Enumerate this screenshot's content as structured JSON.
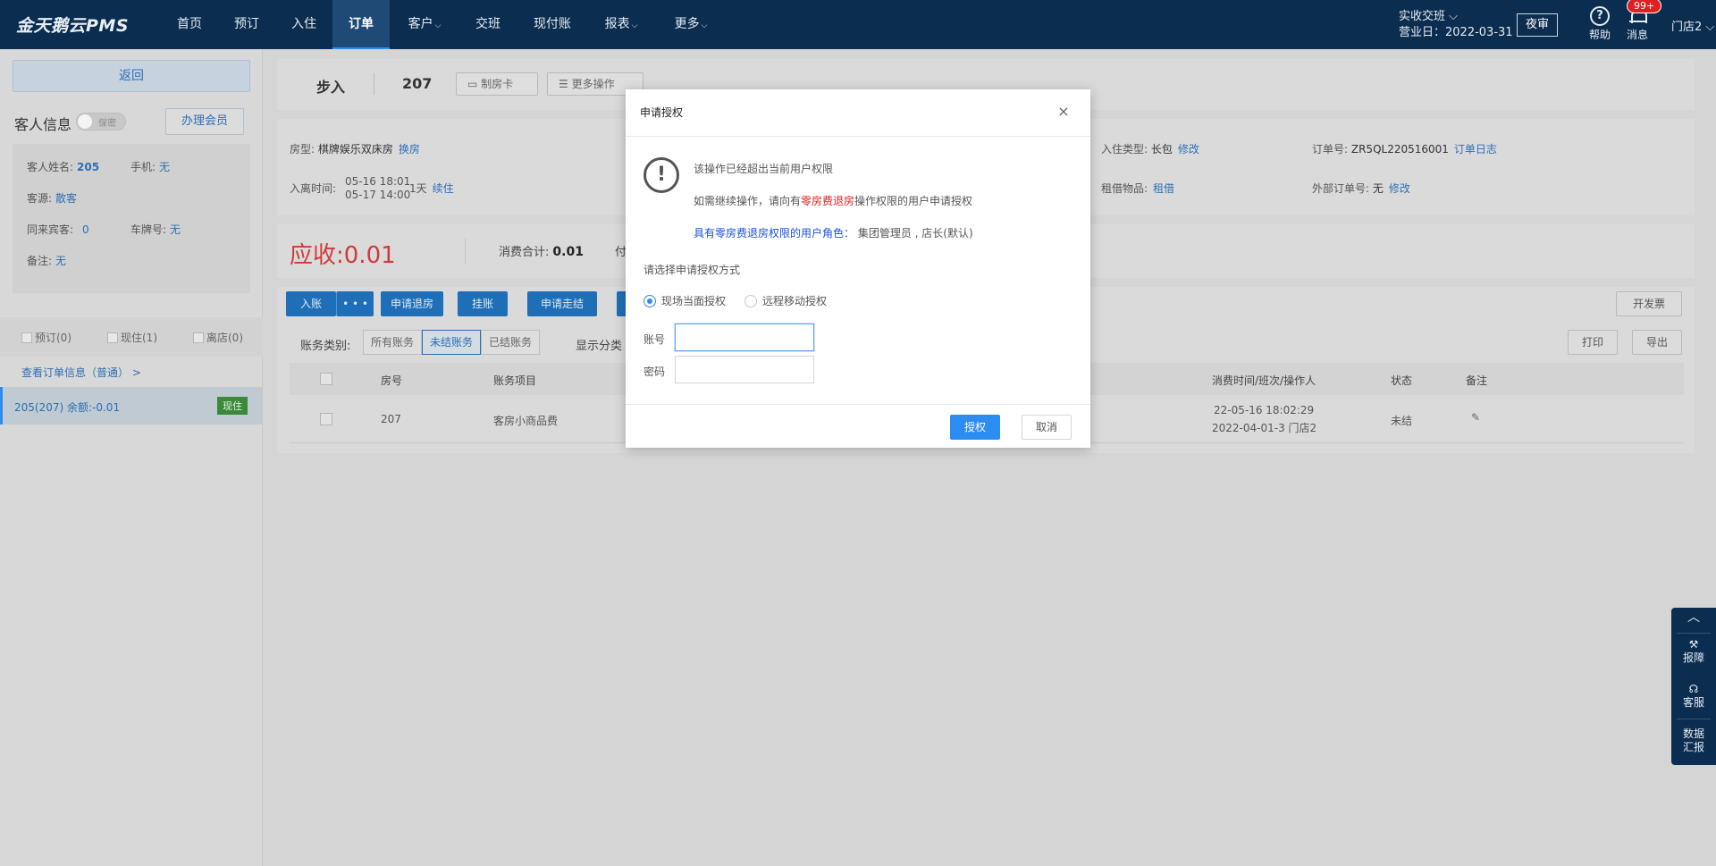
{
  "app": {
    "logo": "金天鹅云PMS"
  },
  "nav": {
    "items": [
      {
        "label": "首页"
      },
      {
        "label": "预订"
      },
      {
        "label": "入住"
      },
      {
        "label": "订单"
      },
      {
        "label": "客户"
      },
      {
        "label": "交班"
      },
      {
        "label": "现付账"
      },
      {
        "label": "报表"
      },
      {
        "label": "更多"
      }
    ],
    "caret": "⌵",
    "shift_label": "实收交班 ⌵",
    "business_day": "营业日：2022-03-31",
    "audit_label": "夜审",
    "help_label": "帮助",
    "help_glyph": "?",
    "msg_label": "消息",
    "msg_badge": "99+",
    "store_label": "门店2 ⌵"
  },
  "left": {
    "back_label": "返回",
    "guest_info_title": "客人信息",
    "privacy_label": "保密",
    "member_label": "办理会员",
    "guest": {
      "name_label": "客人姓名:",
      "name_value": "205",
      "phone_label": "手机:",
      "phone_value": "无",
      "source_label": "客源:",
      "source_value": "散客",
      "companions_label": "同来宾客:",
      "companions_value": "0",
      "plate_label": "车牌号:",
      "plate_value": "无",
      "note_label": "备注:",
      "note_value": "无"
    },
    "filters": [
      {
        "label": "预订(0)"
      },
      {
        "label": "现住(1)"
      },
      {
        "label": "离店(0)"
      }
    ],
    "order_link": "查看订单信息（普通） >",
    "room_item": {
      "label": "205(207)   余额:-0.01",
      "badge": "现住"
    }
  },
  "header": {
    "walkin": "步入",
    "room": "207",
    "make_card_label": "制房卡",
    "more_ops_label": "更多操作"
  },
  "details": {
    "room_type_label": "房型:",
    "room_type_value": "棋牌娱乐双床房",
    "change_room": "换房",
    "stay_label": "入离时间:",
    "stay_in": "05-16 18:01",
    "stay_out": "05-17 14:00",
    "nights": "1天",
    "extend": "续住",
    "checkin_type_label": "入住类型:",
    "checkin_type_value": "长包",
    "modify": "修改",
    "order_no_label": "订单号:",
    "order_no_value": "ZR5QL220516001",
    "order_log": "订单日志",
    "borrow_label": "租借物品:",
    "borrow_value": "租借",
    "ext_order_label": "外部订单号:",
    "ext_order_value": "无",
    "ext_modify": "修改"
  },
  "summary": {
    "due_label": "应收:",
    "due_value": "0.01",
    "consume_label": "消费合计:",
    "consume_value": "0.01",
    "paid_partial": "付"
  },
  "actions": {
    "post": "入账",
    "more": "• • •",
    "apply_checkout": "申请退房",
    "hang": "挂账",
    "apply_walkout": "申请走结",
    "invoice": "开发票",
    "print": "打印",
    "export": "导出"
  },
  "account_filter": {
    "label": "账务类别:",
    "options": [
      "所有账务",
      "未结账务",
      "已结账务"
    ],
    "selected": "未结账务",
    "display_label": "显示分类"
  },
  "table": {
    "headers": [
      "房号",
      "账务项目",
      "消费时间/班次/操作人",
      "状态",
      "备注"
    ],
    "rows": [
      {
        "room": "207",
        "item": "客房小商品费",
        "time": "22-05-16 18:02:29",
        "shift": "2022-04-01-3 门店2",
        "status": "未结"
      }
    ]
  },
  "side_tools": {
    "up": "︿",
    "report_issue": "报障",
    "support": "客服",
    "data_line1": "数据",
    "data_line2": "汇报"
  },
  "modal": {
    "title": "申请授权",
    "close": "×",
    "icon_glyph": "!",
    "line1": "该操作已经超出当前用户权限",
    "line2_pre": "如需继续操作，请向有",
    "line2_red": "零房费退房",
    "line2_post": "操作权限的用户申请授权",
    "line3_blue": "具有零房费退房权限的用户角色：",
    "line3_roles": "集团管理员 , 店长(默认)",
    "choose_label": "请选择申请授权方式",
    "method_onsite": "现场当面授权",
    "method_remote": "远程移动授权",
    "account_label": "账号",
    "account_value": "",
    "password_label": "密码",
    "password_value": "",
    "confirm": "授权",
    "cancel": "取消"
  },
  "colors": {
    "nav_bg": "#0b2d4f",
    "primary": "#2d8cf0",
    "danger": "#e02020",
    "link": "#2d6fb4"
  }
}
